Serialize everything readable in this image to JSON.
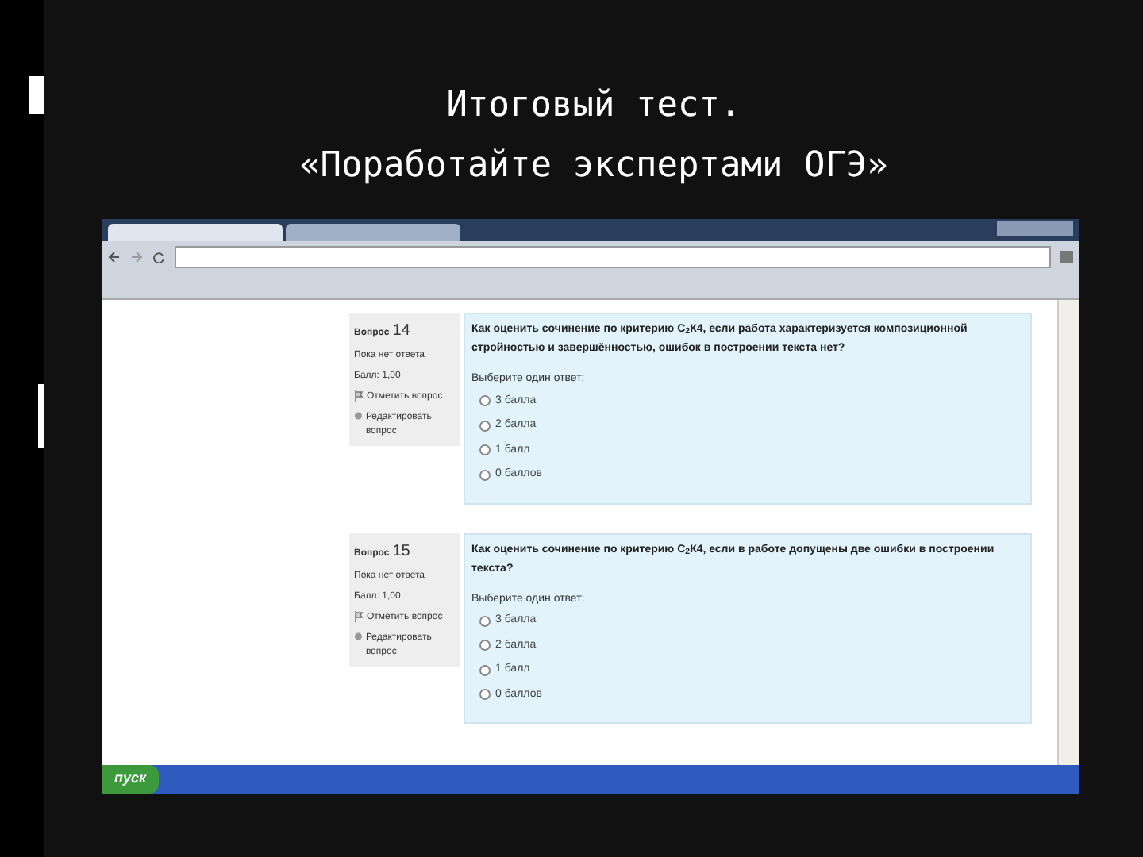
{
  "slide": {
    "title_lines": [
      "Итоговый тест.",
      "«Поработайте экспертами ОГЭ»"
    ]
  },
  "questions": [
    {
      "label": "Вопрос",
      "number": "14",
      "status": "Пока нет ответа",
      "score": "Балл: 1,00",
      "flag": "Отметить вопрос",
      "edit": "Редактировать вопрос",
      "text": "Как оценить сочинение по критерию С$_{2}$К4, если работа характеризуется композиционной стройностью и завершённостью, ошибок в построении текста нет?",
      "prompt": "Выберите один ответ:",
      "options": [
        {
          "label": "3 балла",
          "selected": false
        },
        {
          "label": "2 балла",
          "selected": false
        },
        {
          "label": "1 балл",
          "selected": false
        },
        {
          "label": "0 баллов",
          "selected": false
        }
      ]
    },
    {
      "label": "Вопрос",
      "number": "15",
      "status": "Пока нет ответа",
      "score": "Балл: 1,00",
      "flag": "Отметить вопрос",
      "edit": "Редактировать вопрос",
      "text": "Как оценить сочинение по критерию С$_{2}$К4, если в работе допущены две ошибки в построении текста?",
      "prompt": "Выберите один ответ:",
      "options": [
        {
          "label": "3 балла",
          "selected": false
        },
        {
          "label": "2 балла",
          "selected": false
        },
        {
          "label": "1 балл",
          "selected": false
        },
        {
          "label": "0 баллов",
          "selected": false
        }
      ]
    }
  ],
  "taskbar": {
    "start": "пуск"
  }
}
